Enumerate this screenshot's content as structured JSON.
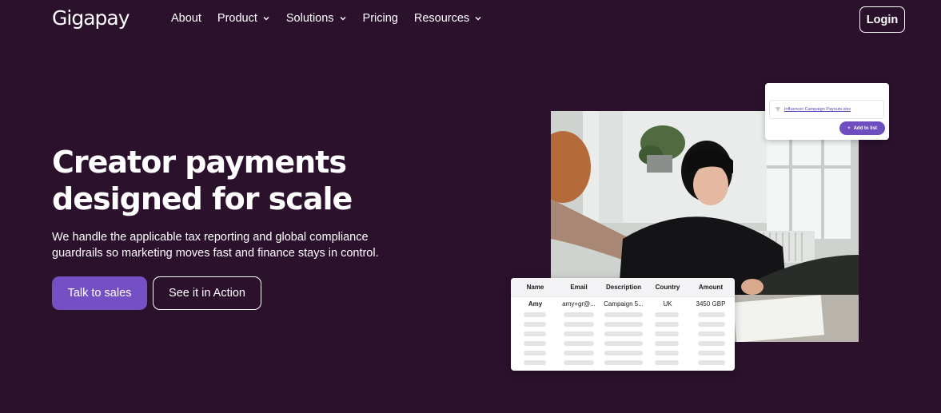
{
  "brand": {
    "logo_text": "Gigapay"
  },
  "nav": {
    "items": [
      {
        "label": "About",
        "has_dropdown": false
      },
      {
        "label": "Product",
        "has_dropdown": true
      },
      {
        "label": "Solutions",
        "has_dropdown": true
      },
      {
        "label": "Pricing",
        "has_dropdown": false
      },
      {
        "label": "Resources",
        "has_dropdown": true
      }
    ],
    "login_label": "Login"
  },
  "hero": {
    "headline_line1": "Creator payments",
    "headline_line2": "designed for scale",
    "subtext_line1": "We handle the applicable tax reporting and global compliance",
    "subtext_line2": "guardrails so marketing moves fast and finance stays in control.",
    "primary_cta": "Talk to sales",
    "secondary_cta": "See it in Action"
  },
  "upload_card": {
    "file_name": "Influencer Campaign Payouts.xlsx",
    "add_button": "Add to list"
  },
  "table": {
    "headers": [
      "Name",
      "Email",
      "Description",
      "Country",
      "Amount"
    ],
    "first_row": [
      "Amy",
      "amy+gr@...",
      "Campaign 5...",
      "UK",
      "3450 GBP"
    ]
  },
  "colors": {
    "background": "#2b112c",
    "accent": "#7450c4",
    "text": "#ffffff"
  }
}
